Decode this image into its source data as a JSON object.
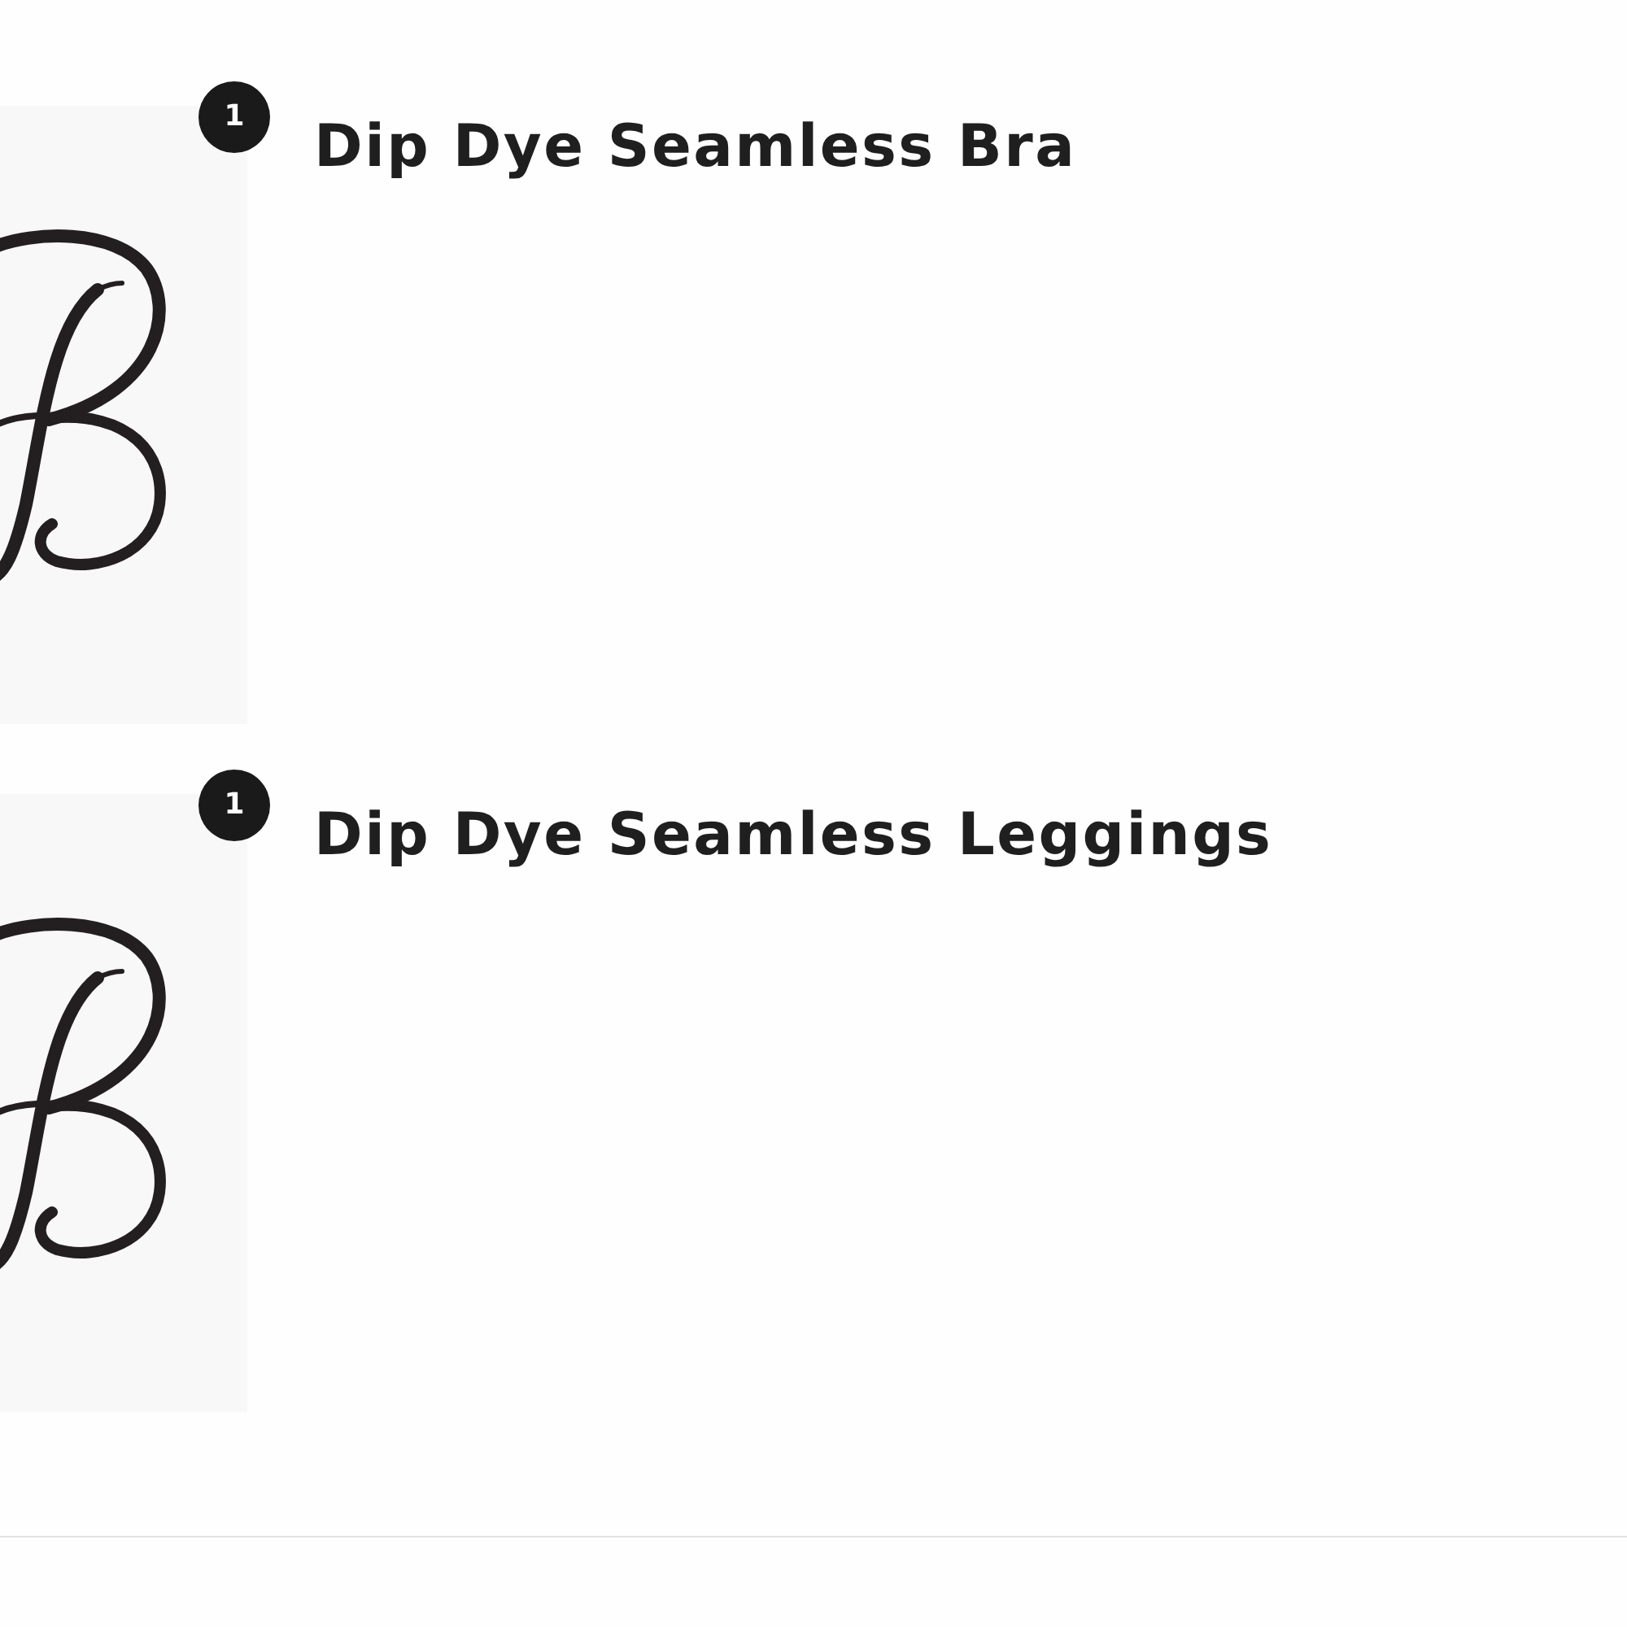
{
  "cart_items": [
    {
      "quantity": "1",
      "name": "Dip Dye Seamless Bra"
    },
    {
      "quantity": "1",
      "name": "Dip Dye Seamless Leggings"
    }
  ]
}
